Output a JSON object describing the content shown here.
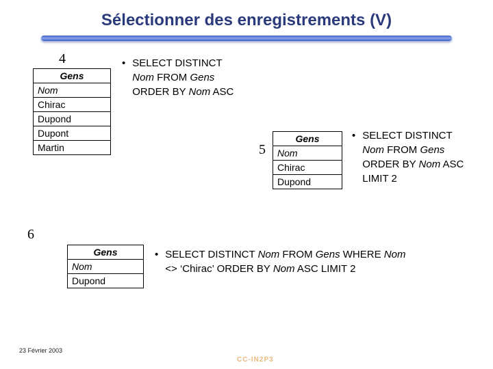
{
  "title": "Sélectionner des enregistrements (V)",
  "box4": {
    "num": "4",
    "table": "Gens",
    "col": "Nom",
    "rows": [
      "Chirac",
      "Dupond",
      "Dupont",
      "Martin"
    ]
  },
  "q4": {
    "l1": "SELECT DISTINCT",
    "l2_pre": "Nom",
    "l2_mid": " FROM ",
    "l2_post": "Gens",
    "l3_pre": "ORDER BY ",
    "l3_post": "Nom",
    "l3_end": " ASC"
  },
  "box5": {
    "num": "5",
    "table": "Gens",
    "col": "Nom",
    "rows": [
      "Chirac",
      "Dupond"
    ]
  },
  "q5": {
    "l1": "SELECT DISTINCT",
    "l2_pre": "Nom",
    "l2_mid": " FROM ",
    "l2_post": "Gens",
    "l3_pre": "ORDER BY ",
    "l3_post": "Nom",
    "l3_end": " ASC",
    "l4": "LIMIT 2"
  },
  "box6": {
    "num": "6",
    "table": "Gens",
    "col": "Nom",
    "rows": [
      "Dupond"
    ]
  },
  "q6": {
    "line1_a": "SELECT DISTINCT ",
    "line1_b": "Nom",
    "line1_c": " FROM ",
    "line1_d": "Gens",
    "line1_e": " WHERE ",
    "line1_f": "Nom",
    "line2_a": "<> ‘Chirac’ ORDER BY ",
    "line2_b": "Nom",
    "line2_c": " ASC LIMIT 2"
  },
  "footer": {
    "date": "23 Février 2003",
    "logo": "CC-IN2P3"
  },
  "chart_data": {
    "type": "table",
    "tables": [
      {
        "id": 4,
        "name": "Gens",
        "column": "Nom",
        "rows": [
          "Chirac",
          "Dupond",
          "Dupont",
          "Martin"
        ]
      },
      {
        "id": 5,
        "name": "Gens",
        "column": "Nom",
        "rows": [
          "Chirac",
          "Dupond"
        ]
      },
      {
        "id": 6,
        "name": "Gens",
        "column": "Nom",
        "rows": [
          "Dupond"
        ]
      }
    ],
    "queries": [
      {
        "id": 4,
        "sql": "SELECT DISTINCT Nom FROM Gens ORDER BY Nom ASC"
      },
      {
        "id": 5,
        "sql": "SELECT DISTINCT Nom FROM Gens ORDER BY Nom ASC LIMIT 2"
      },
      {
        "id": 6,
        "sql": "SELECT DISTINCT Nom FROM Gens WHERE Nom <> 'Chirac' ORDER BY Nom ASC LIMIT 2"
      }
    ]
  }
}
